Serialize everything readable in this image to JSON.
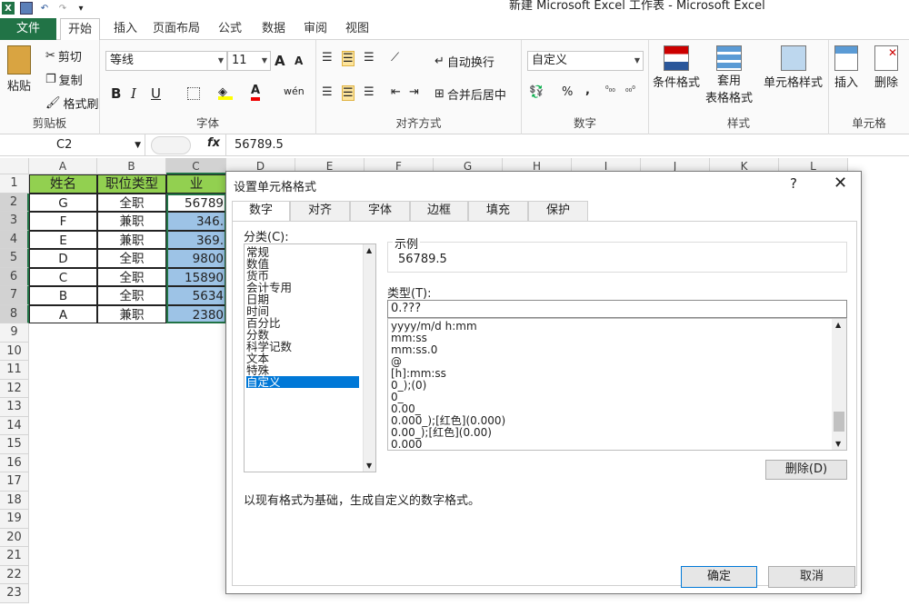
{
  "app": {
    "title": "新建 Microsoft Excel 工作表 - Microsoft Excel"
  },
  "tabs": [
    "文件",
    "开始",
    "插入",
    "页面布局",
    "公式",
    "数据",
    "审阅",
    "视图"
  ],
  "ribbon": {
    "clipboard": {
      "paste": "粘贴",
      "cut": "剪切",
      "copy": "复制",
      "format_painter": "格式刷",
      "label": "剪贴板"
    },
    "font": {
      "name": "等线",
      "size": "11",
      "bold": "B",
      "italic": "I",
      "underline": "U",
      "grow": "A",
      "shrink": "A",
      "label": "字体"
    },
    "align": {
      "wrap": "自动换行",
      "merge": "合并后居中",
      "label": "对齐方式"
    },
    "number": {
      "format": "自定义",
      "percent": "%",
      "comma": ",",
      "inc_dec": ".0\n.00",
      "dec_dec": ".00\n.0",
      "label": "数字"
    },
    "styles": {
      "cond": "条件格式",
      "table": "套用\n表格格式",
      "cell": "单元格样式",
      "label": "样式"
    },
    "cells": {
      "insert": "插入",
      "delete": "删除",
      "label": "单元格"
    }
  },
  "formula_bar": {
    "namebox": "C2",
    "fx": "fx",
    "value": "56789.5"
  },
  "columns": [
    "A",
    "B",
    "C",
    "D",
    "E",
    "F",
    "G",
    "H",
    "I",
    "J",
    "K",
    "L"
  ],
  "rows": [
    "1",
    "2",
    "3",
    "4",
    "5",
    "6",
    "7",
    "8",
    "9",
    "10",
    "11",
    "12",
    "13",
    "14",
    "15",
    "16",
    "17",
    "18",
    "19",
    "20",
    "21",
    "22",
    "23"
  ],
  "sheet": {
    "header": [
      "姓名",
      "职位类型",
      "业"
    ],
    "data": [
      [
        "G",
        "全职",
        "56789"
      ],
      [
        "F",
        "兼职",
        "346."
      ],
      [
        "E",
        "兼职",
        "369."
      ],
      [
        "D",
        "全职",
        "9800"
      ],
      [
        "C",
        "全职",
        "15890"
      ],
      [
        "B",
        "全职",
        "5634"
      ],
      [
        "A",
        "兼职",
        "2380"
      ]
    ]
  },
  "dialog": {
    "title": "设置单元格格式",
    "help": "?",
    "close": "✕",
    "tabs": [
      "数字",
      "对齐",
      "字体",
      "边框",
      "填充",
      "保护"
    ],
    "category_label": "分类(C):",
    "categories": [
      "常规",
      "数值",
      "货币",
      "会计专用",
      "日期",
      "时间",
      "百分比",
      "分数",
      "科学记数",
      "文本",
      "特殊",
      "自定义"
    ],
    "sample_label": "示例",
    "sample_value": "56789.5",
    "type_label": "类型(T):",
    "type_value": "0.???",
    "type_list": [
      "yyyy/m/d h:mm",
      "mm:ss",
      "mm:ss.0",
      "@",
      "[h]:mm:ss",
      "0_);(0)",
      "0_",
      "0.00_",
      "0.000_);[红色](0.000)",
      "0.00_);[红色](0.00)",
      "0.000"
    ],
    "delete": "删除(D)",
    "hint": "以现有格式为基础，生成自定义的数字格式。",
    "ok": "确定",
    "cancel": "取消"
  },
  "colors": {
    "accent": "#217346",
    "header_green": "#92d050",
    "selection_blue": "#9dc3e6",
    "list_select": "#0078d7"
  }
}
